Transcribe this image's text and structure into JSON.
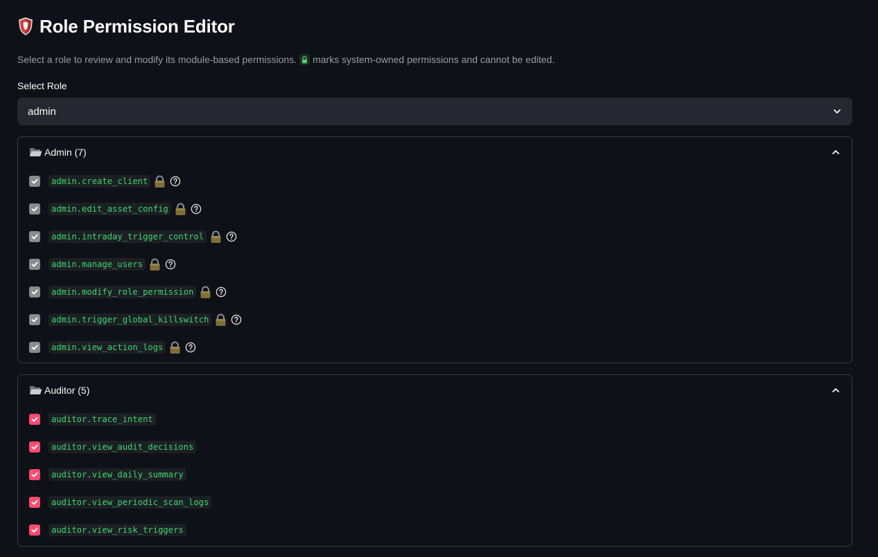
{
  "header": {
    "title": "Role Permission Editor",
    "description_before": "Select a role to review and modify its module-based permissions.",
    "description_after": "marks system-owned permissions and cannot be edited."
  },
  "role_select": {
    "label": "Select Role",
    "value": "admin"
  },
  "groups": [
    {
      "title": "Admin (7)",
      "permissions": [
        {
          "name": "admin.create_client",
          "checked": true,
          "locked": true
        },
        {
          "name": "admin.edit_asset_config",
          "checked": true,
          "locked": true
        },
        {
          "name": "admin.intraday_trigger_control",
          "checked": true,
          "locked": true
        },
        {
          "name": "admin.manage_users",
          "checked": true,
          "locked": true
        },
        {
          "name": "admin.modify_role_permission",
          "checked": true,
          "locked": true
        },
        {
          "name": "admin.trigger_global_killswitch",
          "checked": true,
          "locked": true
        },
        {
          "name": "admin.view_action_logs",
          "checked": true,
          "locked": true
        }
      ]
    },
    {
      "title": "Auditor (5)",
      "permissions": [
        {
          "name": "auditor.trace_intent",
          "checked": true,
          "locked": false
        },
        {
          "name": "auditor.view_audit_decisions",
          "checked": true,
          "locked": false
        },
        {
          "name": "auditor.view_daily_summary",
          "checked": true,
          "locked": false
        },
        {
          "name": "auditor.view_periodic_scan_logs",
          "checked": true,
          "locked": false
        },
        {
          "name": "auditor.view_risk_triggers",
          "checked": true,
          "locked": false
        }
      ]
    }
  ],
  "colors": {
    "background": "#0e1117",
    "checkbox_active": "#ff4b6e",
    "checkbox_locked": "#8a8b90",
    "code_text": "#3dd56d"
  }
}
